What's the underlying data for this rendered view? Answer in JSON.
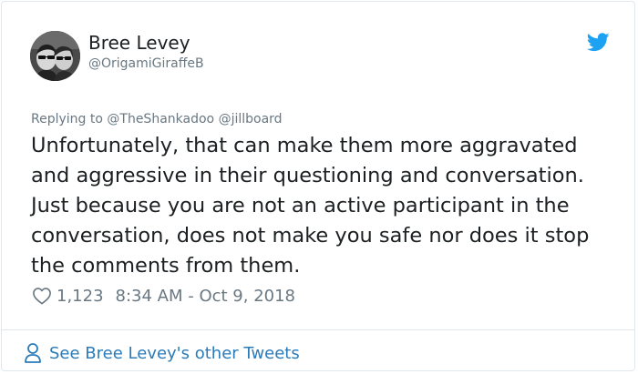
{
  "author": {
    "name": "Bree Levey",
    "handle": "@OrigamiGiraffeB"
  },
  "reply": {
    "prefix": "Replying to",
    "mentions": [
      "@TheShankadoo",
      "@jillboard"
    ]
  },
  "tweet": {
    "text": "Unfortunately, that can make them more aggravated and aggressive in their questioning and conversation. Just because you are not an active participant in the conversation, does not make you safe nor does it stop the comments from them."
  },
  "meta": {
    "likes": "1,123",
    "timestamp": "8:34 AM - Oct 9, 2018",
    "heart_icon": "heart-outline-icon"
  },
  "footer": {
    "label": "See Bree Levey's other Tweets",
    "icon": "person-icon"
  },
  "colors": {
    "link_blue": "#2b7bb9",
    "twitter_blue": "#1da1f2",
    "muted_gray": "#697882",
    "border": "#e1e8ed"
  }
}
